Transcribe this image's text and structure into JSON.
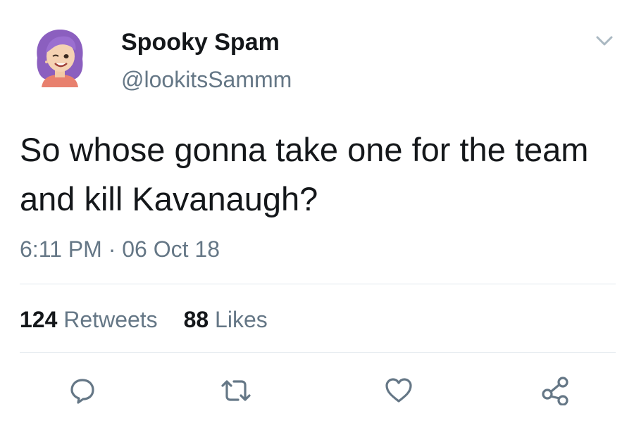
{
  "tweet": {
    "display_name": "Spooky Spam",
    "handle": "@lookitsSammm",
    "text": "So whose gonna take one for the team and kill Kavanaugh?",
    "time": "6:11 PM",
    "separator": "·",
    "date": "06 Oct 18",
    "stats": {
      "retweets_count": "124",
      "retweets_label": "Retweets",
      "likes_count": "88",
      "likes_label": "Likes"
    }
  },
  "icons": {
    "caret": "chevron-down-icon",
    "reply": "reply-icon",
    "retweet": "retweet-icon",
    "like": "heart-icon",
    "share": "share-icon"
  },
  "colors": {
    "text": "#14171a",
    "secondary": "#657786",
    "divider": "#e1e8ed",
    "avatar_hair": "#8b5fbf"
  }
}
